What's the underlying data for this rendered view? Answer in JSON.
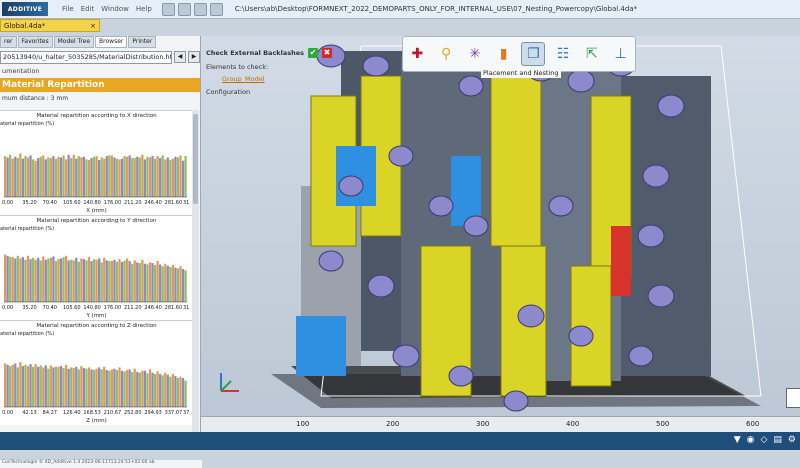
{
  "titlebar": {
    "logo": "ADDITIVE",
    "menu": [
      "File",
      "Edit",
      "Window",
      "Help"
    ],
    "path": "C:\\Users\\ab\\Desktop\\FORMNEXT_2022_DEMOPARTS_ONLY_FOR_INTERNAL_USE\\07_Nesting_Powercopy\\Global.4da*"
  },
  "doc_tab": {
    "label": "Global.4da*",
    "close": "×"
  },
  "left_panel": {
    "tabs": [
      "rer",
      "Favorites",
      "Model Tree",
      "Browser",
      "Printer"
    ],
    "active_tab": "Browser",
    "url": "20513940/u_halter_5035285/MaterialDistribution.html",
    "doc_label": "umentation",
    "banner": "Material Repartition",
    "min_distance": "mum distance : 3 mm",
    "status_text": "ConTechnologie © 4D_Additive 1.4 2023-06-11T13:24:51+02:00 ab"
  },
  "charts": {
    "x_title": "Material repartition according to X direction",
    "y_title": "Material repartition according to Y direction",
    "z_title": "Material repartition according to Z direction",
    "ylabel": "aterial repartition (%)",
    "x_axis": "X (mm)",
    "y_axis": "Y (mm)",
    "z_axis": "Z (mm)",
    "x_ticks": [
      "0.00",
      "35.20",
      "70.40",
      "105.60",
      "140.80",
      "176.00",
      "211.20",
      "246.40",
      "281.60",
      "31"
    ],
    "y_ticks": [
      "0.00",
      "35.20",
      "70.40",
      "105.60",
      "140.80",
      "176.00",
      "211.20",
      "246.40",
      "281.60",
      "31"
    ],
    "z_ticks": [
      "0.00",
      "42.13",
      "84.27",
      "126.40",
      "168.53",
      "210.67",
      "252.80",
      "294.93",
      "337.07",
      "37"
    ]
  },
  "chart_data": [
    {
      "type": "bar",
      "title": "Material repartition according to X direction",
      "xlabel": "X (mm)",
      "ylabel": "aterial repartition (%)",
      "series": [
        {
          "values": [
            62,
            58,
            66,
            60,
            55,
            63,
            59,
            61,
            57,
            64,
            60,
            56,
            62,
            58,
            63,
            57,
            61,
            59,
            64,
            60,
            62,
            57,
            58,
            63
          ]
        },
        {
          "values": [
            60,
            61,
            58,
            63,
            59,
            57,
            62,
            60,
            64,
            58,
            61,
            59,
            56,
            62,
            60,
            58,
            63,
            61,
            57,
            62,
            59,
            60,
            61,
            55
          ]
        },
        {
          "values": [
            64,
            59,
            62,
            57,
            61,
            60,
            58,
            63,
            59,
            62,
            57,
            61,
            60,
            63,
            58,
            62,
            59,
            60,
            61,
            58,
            63,
            56,
            60,
            62
          ]
        }
      ]
    },
    {
      "type": "bar",
      "title": "Material repartition according to Y direction",
      "xlabel": "Y (mm)",
      "ylabel": "aterial repartition (%)",
      "series": [
        {
          "values": [
            72,
            68,
            66,
            70,
            64,
            69,
            67,
            65,
            70,
            63,
            66,
            68,
            64,
            67,
            62,
            65,
            66,
            63,
            64,
            60,
            62,
            58,
            56,
            54
          ]
        },
        {
          "values": [
            70,
            66,
            68,
            65,
            67,
            64,
            69,
            66,
            63,
            67,
            65,
            62,
            66,
            63,
            64,
            61,
            62,
            60,
            58,
            59,
            57,
            55,
            52,
            50
          ]
        },
        {
          "values": [
            68,
            70,
            64,
            67,
            63,
            66,
            62,
            68,
            64,
            61,
            63,
            65,
            60,
            62,
            61,
            63,
            58,
            59,
            57,
            56,
            54,
            53,
            51,
            48
          ]
        }
      ]
    },
    {
      "type": "bar",
      "title": "Material repartition according to Z direction",
      "xlabel": "Z (mm)",
      "ylabel": "aterial repartition (%)",
      "series": [
        {
          "values": [
            66,
            64,
            68,
            62,
            65,
            60,
            63,
            61,
            64,
            59,
            62,
            60,
            58,
            61,
            57,
            60,
            56,
            58,
            55,
            57,
            54,
            52,
            50,
            46
          ]
        },
        {
          "values": [
            64,
            66,
            62,
            65,
            61,
            63,
            60,
            62,
            58,
            61,
            59,
            57,
            60,
            56,
            58,
            55,
            57,
            53,
            55,
            52,
            50,
            49,
            47,
            44
          ]
        },
        {
          "values": [
            62,
            60,
            64,
            61,
            63,
            58,
            61,
            59,
            60,
            57,
            58,
            56,
            57,
            55,
            56,
            54,
            53,
            52,
            51,
            50,
            48,
            46,
            44,
            40
          ]
        }
      ]
    }
  ],
  "tree": {
    "header": "Check External Backlashes",
    "ok": "✔",
    "cancel": "✖",
    "elements": "Elements to check:",
    "group": "Group_Model",
    "configuration": "Configuration"
  },
  "toolbar": {
    "tooltip": "Placement and Nesting",
    "icons": [
      "add-icon",
      "support-icon",
      "star-icon",
      "chart-icon",
      "nesting-icon",
      "layout-icon",
      "export-icon",
      "tool-icon"
    ],
    "glyphs": [
      "✚",
      "⚲",
      "✳",
      "▮",
      "❐",
      "☷",
      "⇱",
      "⊥"
    ],
    "colors": [
      "#c8102e",
      "#e8a623",
      "#8a3fb0",
      "#e07b1f",
      "#2f78c4",
      "#2f78c4",
      "#2aa34a",
      "#2f78c4"
    ]
  },
  "ruler": {
    "ticks": [
      "100",
      "200",
      "300",
      "400",
      "500",
      "600"
    ]
  },
  "colors": {
    "banner": "#e8a623",
    "bar_orange": "#e39a52",
    "bar_purple": "#8d87d1",
    "bar_green": "#8fc25a",
    "part_yellow": "#d9d426",
    "part_blue": "#2f8fe0",
    "part_purple": "#8c89cc",
    "part_dark": "#4c5868"
  }
}
